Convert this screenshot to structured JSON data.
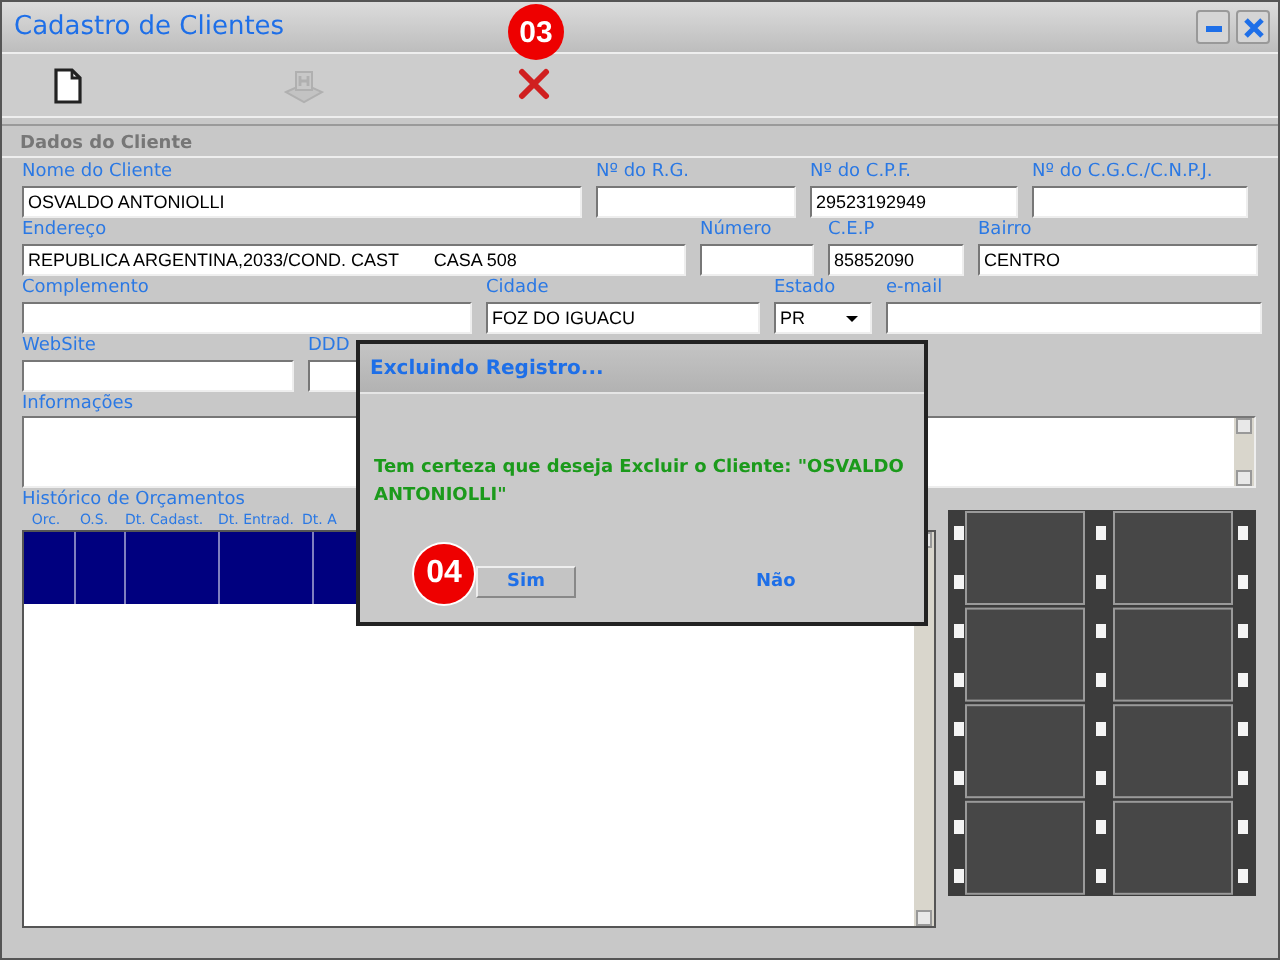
{
  "window": {
    "title": "Cadastro de Clientes",
    "controls": [
      {
        "kind": "minimize"
      },
      {
        "kind": "close"
      }
    ]
  },
  "toolbar": [
    {
      "kind": "new",
      "disabled": false
    },
    {
      "kind": "save",
      "disabled": true
    },
    {
      "kind": "delete",
      "disabled": false,
      "badge": "03"
    }
  ],
  "section": "Dados do Cliente",
  "form_rows": [
    {
      "fields": [
        {
          "label": "Nome do Cliente",
          "value": "OSVALDO ANTONIOLLI",
          "kind": "text"
        },
        {
          "label": "Nº do R.G.",
          "kind": "text"
        },
        {
          "label": "Nº do C.P.F.",
          "value": "29523192949",
          "kind": "text"
        },
        {
          "label": "Nº do C.G.C./C.N.P.J.",
          "kind": "text"
        }
      ]
    },
    {
      "fields": [
        {
          "label": "Endereço",
          "value": "REPUBLICA ARGENTINA,2033/COND. CAST       CASA 508",
          "kind": "text"
        },
        {
          "label": "Número",
          "kind": "text"
        },
        {
          "label": "C.E.P",
          "value": "85852090",
          "kind": "text"
        },
        {
          "label": "Bairro",
          "value": "CENTRO",
          "kind": "text"
        }
      ]
    },
    {
      "fields": [
        {
          "label": "Complemento",
          "kind": "text"
        },
        {
          "label": "Cidade",
          "value": "FOZ DO IGUACU",
          "kind": "text"
        },
        {
          "label": "Estado",
          "value": "PR",
          "kind": "select"
        },
        {
          "label": "e-mail",
          "kind": "text"
        }
      ]
    },
    {
      "fields": [
        {
          "label": "WebSite",
          "kind": "text"
        },
        {
          "label": "DDD",
          "kind": "text"
        }
      ]
    }
  ],
  "notes": {
    "label": "Informações"
  },
  "history": {
    "title": "Histórico de Orçamentos",
    "columns": [
      "Orc.",
      "O.S.",
      "Dt. Cadast.",
      "Dt. Entrad.",
      "Dt. A"
    ]
  },
  "dialog": {
    "title": "Excluindo Registro...",
    "message": "Tem certeza que deseja Excluir o Cliente: \"OSVALDO ANTONIOLLI\"",
    "badge": "04",
    "buttons": [
      {
        "label": "Sim",
        "kind": "button"
      },
      {
        "label": "Não",
        "kind": "link"
      }
    ]
  }
}
